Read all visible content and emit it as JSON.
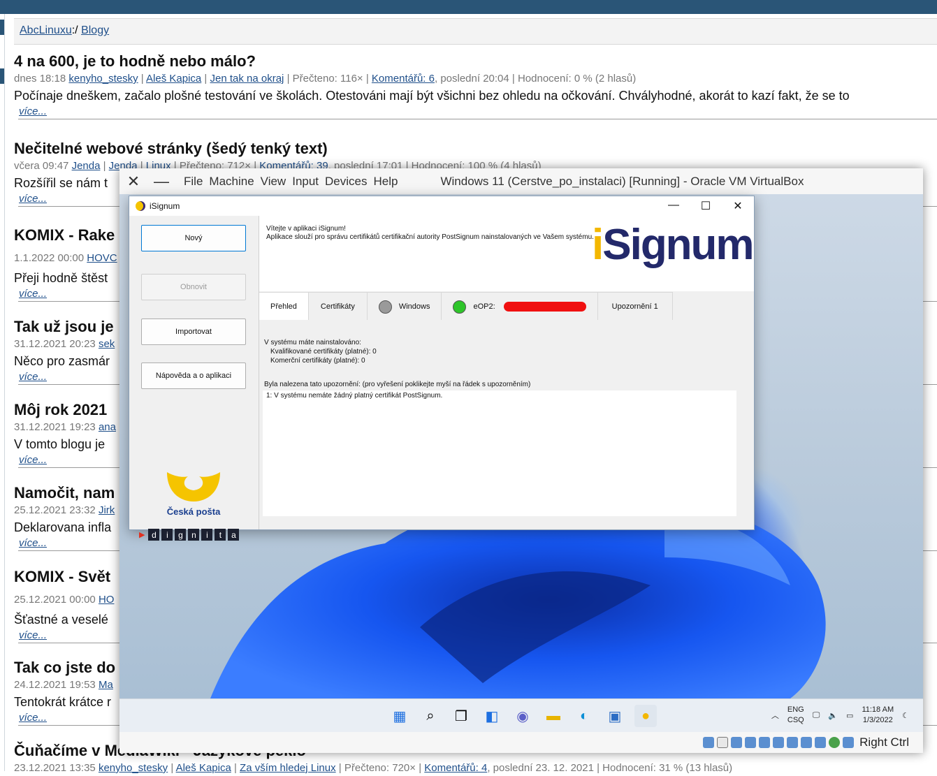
{
  "blog": {
    "breadcrumb": {
      "home": "AbcLinuxu",
      "sep": ":/",
      "section": "Blogy"
    },
    "posts": [
      {
        "title": "4 na 600, je to hodně nebo málo?",
        "date": "dnes 18:18",
        "user": "kenyho_stesky",
        "author": "Aleš Kapica",
        "blog": "Jen tak na okraj",
        "reads": "Přečteno: 116×",
        "comments": "Komentářů: 6",
        "rest": ", poslední 20:04 | Hodnocení: 0 % (2 hlasů)",
        "perex": "Počínaje dneškem, začalo plošné testování ve školách. Otestováni mají být všichni bez ohledu na očkování. Chvályhodné, akorát to kazí fakt, že se to",
        "more": "více..."
      },
      {
        "title": "Nečitelné webové stránky (šedý tenký text)",
        "date": "včera 09:47",
        "user": "Jenda",
        "author": "Jenda",
        "blog": "Linux",
        "reads": "Přečteno: 712×",
        "comments": "Komentářů: 39",
        "rest": ", poslední 17:01 | Hodnocení: 100 % (4 hlasů)",
        "perex": "Rozšířil se nám t",
        "more": "více..."
      },
      {
        "title": "KOMIX - Rake",
        "date": "1.1.2022 00:00",
        "user": "HOVC",
        "perex": "Přeji hodně štěst",
        "more": "více..."
      },
      {
        "title": "Tak už jsou je",
        "date": "31.12.2021 20:23",
        "user": "sek",
        "perex": "Něco pro zasmár",
        "more": "více..."
      },
      {
        "title": "Môj rok 2021",
        "date": "31.12.2021 19:23",
        "user": "ana",
        "perex": "V tomto blogu je",
        "more": "více..."
      },
      {
        "title": "Namočit, nam",
        "date": "25.12.2021 23:32",
        "user": "Jirk",
        "perex": "Deklarovana infla",
        "more": "více..."
      },
      {
        "title": "KOMIX - Svět",
        "date": "25.12.2021 00:00",
        "user": "HO",
        "perex": "Šťastné a veselé",
        "more": "více..."
      },
      {
        "title": "Tak co jste do",
        "date": "24.12.2021 19:53",
        "user": "Ma",
        "perex": "Tentokrát krátce r",
        "more": "více..."
      },
      {
        "title": "Čuňačíme v MediaWiki - Jazykové peklo",
        "date": "23.12.2021 13:35",
        "user": "kenyho_stesky",
        "author": "Aleš Kapica",
        "blog": "Za vším hledej Linux",
        "reads": "Přečteno: 720×",
        "comments": "Komentářů: 4",
        "rest": ", poslední 23. 12. 2021 | Hodnocení: 31 % (13 hlasů)"
      }
    ]
  },
  "virtualbox": {
    "menu": [
      "File",
      "Machine",
      "View",
      "Input",
      "Devices",
      "Help"
    ],
    "title": "Windows 11 (Cerstve_po_instalaci) [Running] - Oracle VM VirtualBox",
    "host_key": "Right Ctrl"
  },
  "taskbar": {
    "lang": "ENG",
    "ime": "CSQ",
    "time": "11:18 AM",
    "date": "1/3/2022"
  },
  "isignum": {
    "window_title": "iSignum",
    "buttons": {
      "new": "Nový",
      "refresh": "Obnovit",
      "import": "Importovat",
      "help": "Nápověda a o aplikaci"
    },
    "welcome_line1": "Vítejte v aplikaci iSignum!",
    "welcome_line2": "Aplikace slouží pro správu certifikátů certifikační autority PostSignum nainstalovaných ve Vašem systému.",
    "brand_i": "i",
    "brand_rest": "Signum",
    "tabs": {
      "overview": "Přehled",
      "certs": "Certifikáty",
      "windows": "Windows",
      "eop": "eOP2:",
      "alerts": "Upozornění 1"
    },
    "installed_head": "V systému máte nainstalováno:",
    "qualified": "Kvalifikované certifikáty (platné): 0",
    "commercial": "Komerční certifikáty (platné): 0",
    "warn_head": "Byla nalezena tato upozornění: (pro vyřešení poklikejte myší na řádek s upozorněním)",
    "warn_item": "1: V systému nemáte žádný platný certifikát PostSignum.",
    "cp_name": "Česká pošta",
    "dignita": [
      "d",
      "i",
      "g",
      "n",
      "i",
      "t",
      "a"
    ]
  }
}
